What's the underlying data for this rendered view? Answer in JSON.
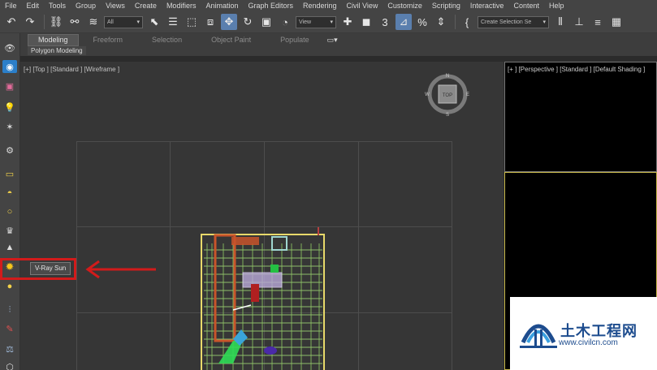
{
  "menubar": {
    "items": [
      "File",
      "Edit",
      "Tools",
      "Group",
      "Views",
      "Create",
      "Modifiers",
      "Animation",
      "Graph Editors",
      "Rendering",
      "Civil View",
      "Customize",
      "Scripting",
      "Interactive",
      "Content",
      "Help"
    ]
  },
  "toolbar": {
    "filter_value": "All",
    "ref_coord_value": "View",
    "selection_set_placeholder": "Create Selection Se",
    "snap_label": "3",
    "percent_label": "%"
  },
  "ribbon": {
    "tabs": [
      "Modeling",
      "Freeform",
      "Selection",
      "Object Paint",
      "Populate"
    ],
    "active_tab": "Modeling",
    "sub_label": "Polygon Modeling"
  },
  "viewports": {
    "top_label": "[+] [Top ] [Standard ] [Wireframe ]",
    "perspective_label": "[+ ] [Perspective ] [Standard ] [Default Shading ]"
  },
  "viewcube": {
    "face": "TOP",
    "n": "N",
    "s": "S",
    "e": "E",
    "w": "W"
  },
  "tooltip": {
    "text": "V-Ray Sun"
  },
  "watermark": {
    "title": "土木工程网",
    "url": "www.civilcn.com"
  },
  "colors": {
    "highlight": "#d21b1b",
    "accent": "#5a7fae",
    "selection_yellow": "#c8b84a"
  }
}
